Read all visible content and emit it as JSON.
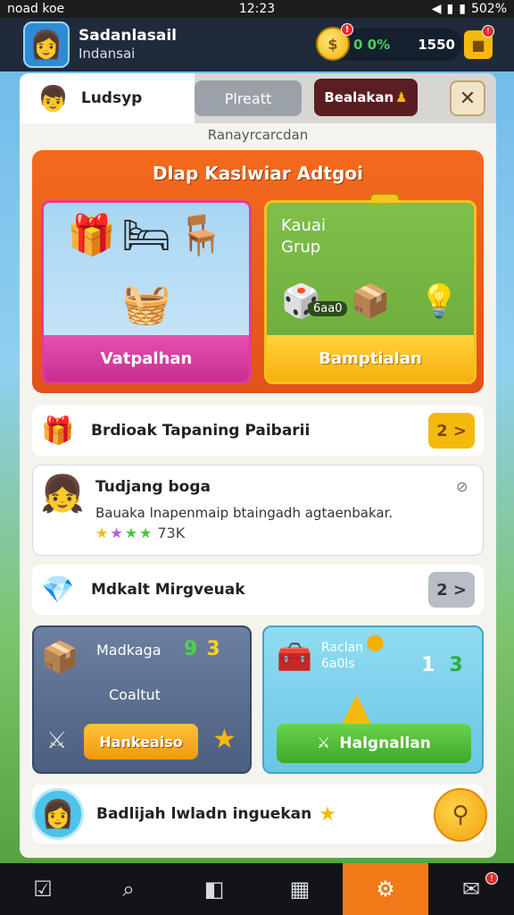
{
  "status": {
    "carrier": "noad koe",
    "time": "12:23",
    "battery": "502%",
    "signal_icon": "signal-icon",
    "battery_icon": "battery-icon"
  },
  "header": {
    "name": "Sadanlasail",
    "subtitle": "Indansai",
    "currency_pct": "0 0%",
    "currency_amount": "1550",
    "coin_badge": "!",
    "shop_badge": "!"
  },
  "tabs": [
    {
      "label": "Ludsyp"
    },
    {
      "label": "Plreatt"
    },
    {
      "label": "Bealakan"
    }
  ],
  "close_label": "✕",
  "subtitle": "Ranayrcarcdan",
  "featured": {
    "title": "Dlap Kaslwiar Adtgoi",
    "left_button": "Vatpalhan",
    "right_title_1": "Kauai",
    "right_title_2": "Grup",
    "right_count": "6aa0",
    "right_button": "Bamptialan"
  },
  "row1": {
    "title": "Brdioak Tapaning Paibarii",
    "button": "2 >"
  },
  "quest": {
    "title": "Tudjang boga",
    "desc": "Bauaka lnapenmaip btaingadh agtaenbakar.",
    "count": "73K"
  },
  "row2": {
    "title": "Mdkalt Mirgveuak",
    "button": "2 >"
  },
  "card_bl": {
    "title": "Madkaga",
    "num_green": "9",
    "num_yellow": "3",
    "sub": "Coaltut",
    "button": "Hankeaiso"
  },
  "card_br": {
    "title_1": "Raclan",
    "title_2": "6a0ls",
    "num_white": "1",
    "num_green": "3",
    "button": "Halgnallan"
  },
  "row3": {
    "title": "Badlijah lwladn inguekan"
  },
  "colors": {
    "accent_orange": "#f07a18",
    "pink": "#e550b0",
    "gold": "#f5b90e",
    "green": "#3eaa2a"
  }
}
